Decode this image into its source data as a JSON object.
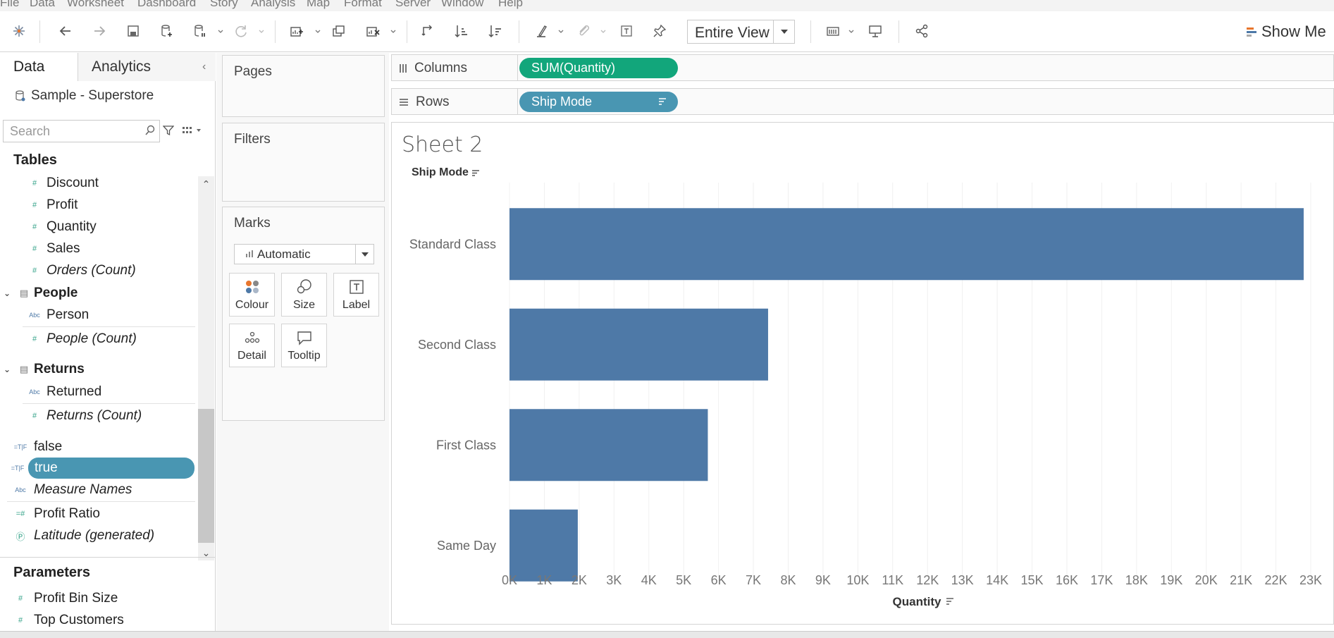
{
  "menu": [
    "File",
    "Data",
    "Worksheet",
    "Dashboard",
    "Story",
    "Analysis",
    "Map",
    "Format",
    "Server",
    "Window",
    "Help"
  ],
  "toolbar": {
    "fit_label": "Entire View",
    "show_me_label": "Show Me"
  },
  "data_pane": {
    "tabs": [
      "Data",
      "Analytics"
    ],
    "datasource": "Sample - Superstore",
    "search_placeholder": "Search",
    "section_tables": "Tables",
    "section_parameters": "Parameters",
    "fields": [
      {
        "name": "Discount",
        "icon": "measure-icon",
        "italic": false
      },
      {
        "name": "Profit",
        "icon": "measure-icon",
        "italic": false
      },
      {
        "name": "Quantity",
        "icon": "measure-icon",
        "italic": false
      },
      {
        "name": "Sales",
        "icon": "measure-icon",
        "italic": false
      },
      {
        "name": "Orders (Count)",
        "icon": "measure-icon",
        "italic": true
      }
    ],
    "folder_people": "People",
    "people_fields": [
      {
        "name": "Person",
        "icon": "string-icon",
        "italic": false
      },
      {
        "name": "People (Count)",
        "icon": "measure-icon",
        "italic": true
      }
    ],
    "folder_returns": "Returns",
    "returns_fields": [
      {
        "name": "Returned",
        "icon": "string-icon",
        "italic": false
      },
      {
        "name": "Returns (Count)",
        "icon": "measure-icon",
        "italic": true
      }
    ],
    "loose_fields": [
      {
        "name": "false",
        "icon": "boolean-icon",
        "italic": false
      },
      {
        "name": "true",
        "icon": "boolean-icon",
        "italic": false,
        "selected": true
      },
      {
        "name": "Measure Names",
        "icon": "string-icon",
        "italic": true
      },
      {
        "name": "Profit Ratio",
        "icon": "calc-measure-icon",
        "italic": false
      },
      {
        "name": "Latitude (generated)",
        "icon": "globe-icon",
        "italic": true
      }
    ],
    "parameters": [
      {
        "name": "Profit Bin Size",
        "icon": "measure-icon"
      },
      {
        "name": "Top Customers",
        "icon": "measure-icon"
      }
    ]
  },
  "cards": {
    "pages": "Pages",
    "filters": "Filters",
    "marks": "Marks",
    "mark_type": "Automatic",
    "mark_buttons": [
      "Colour",
      "Size",
      "Label",
      "Detail",
      "Tooltip"
    ]
  },
  "shelves": {
    "columns_label": "Columns",
    "columns_pill": "SUM(Quantity)",
    "rows_label": "Rows",
    "rows_pill": "Ship Mode"
  },
  "view": {
    "sheet_title": "Sheet 2",
    "rows_header": "Ship Mode"
  },
  "chart_data": {
    "type": "bar",
    "orientation": "horizontal",
    "categories": [
      "Standard Class",
      "Second Class",
      "First Class",
      "Same Day"
    ],
    "values": [
      22797,
      7423,
      5693,
      1960
    ],
    "xlabel": "Quantity",
    "xlim": [
      0,
      23000
    ],
    "x_ticks": [
      "0K",
      "1K",
      "2K",
      "3K",
      "4K",
      "5K",
      "6K",
      "7K",
      "8K",
      "9K",
      "10K",
      "11K",
      "12K",
      "13K",
      "14K",
      "15K",
      "16K",
      "17K",
      "18K",
      "19K",
      "20K",
      "21K",
      "22K",
      "23K"
    ],
    "bar_color": "#4e79a7",
    "grid": "vertical"
  },
  "colors": {
    "columns_pill": "#12a67b",
    "rows_pill": "#4996b2",
    "bar": "#4e79a7"
  }
}
